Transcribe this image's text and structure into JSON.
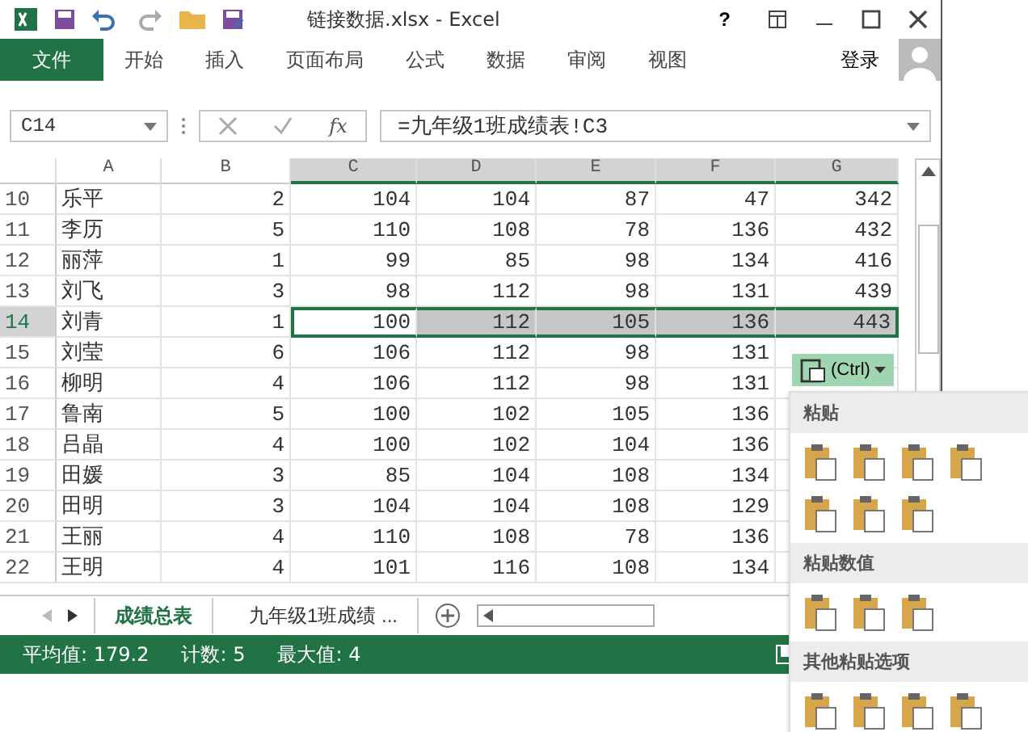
{
  "window": {
    "title": "链接数据.xlsx - Excel",
    "help": "?"
  },
  "ribbon_tabs": [
    {
      "label": "文件",
      "selected": true
    },
    {
      "label": "开始",
      "selected": false
    },
    {
      "label": "插入",
      "selected": false
    },
    {
      "label": "页面布局",
      "selected": false
    },
    {
      "label": "公式",
      "selected": false
    },
    {
      "label": "数据",
      "selected": false
    },
    {
      "label": "审阅",
      "selected": false
    },
    {
      "label": "视图",
      "selected": false
    }
  ],
  "sign_in": "登录",
  "formula_bar": {
    "name_box": "C14",
    "fx": "fx",
    "formula": "=九年级1班成绩表!C3"
  },
  "sheet": {
    "columns": [
      {
        "label": "A",
        "selected": false
      },
      {
        "label": "B",
        "selected": false
      },
      {
        "label": "C",
        "selected": true
      },
      {
        "label": "D",
        "selected": true
      },
      {
        "label": "E",
        "selected": true
      },
      {
        "label": "F",
        "selected": true
      },
      {
        "label": "G",
        "selected": true
      }
    ],
    "rows": [
      {
        "number": "10",
        "selected": false,
        "cells": [
          "乐平",
          "2",
          "104",
          "104",
          "87",
          "47",
          "342"
        ]
      },
      {
        "number": "11",
        "selected": false,
        "cells": [
          "李历",
          "5",
          "110",
          "108",
          "78",
          "136",
          "432"
        ]
      },
      {
        "number": "12",
        "selected": false,
        "cells": [
          "丽萍",
          "1",
          "99",
          "85",
          "98",
          "134",
          "416"
        ]
      },
      {
        "number": "13",
        "selected": false,
        "cells": [
          "刘飞",
          "3",
          "98",
          "112",
          "98",
          "131",
          "439"
        ]
      },
      {
        "number": "14",
        "selected": true,
        "cells": [
          "刘青",
          "1",
          "100",
          "112",
          "105",
          "136",
          "443"
        ]
      },
      {
        "number": "15",
        "selected": false,
        "cells": [
          "刘莹",
          "6",
          "106",
          "112",
          "98",
          "131"
        ]
      },
      {
        "number": "16",
        "selected": false,
        "cells": [
          "柳明",
          "4",
          "106",
          "112",
          "98",
          "131"
        ]
      },
      {
        "number": "17",
        "selected": false,
        "cells": [
          "鲁南",
          "5",
          "100",
          "102",
          "105",
          "136"
        ]
      },
      {
        "number": "18",
        "selected": false,
        "cells": [
          "吕晶",
          "4",
          "100",
          "102",
          "104",
          "136"
        ]
      },
      {
        "number": "19",
        "selected": false,
        "cells": [
          "田媛",
          "3",
          "85",
          "104",
          "108",
          "134"
        ]
      },
      {
        "number": "20",
        "selected": false,
        "cells": [
          "田明",
          "3",
          "104",
          "104",
          "108",
          "129"
        ]
      },
      {
        "number": "21",
        "selected": false,
        "cells": [
          "王丽",
          "4",
          "110",
          "108",
          "78",
          "136"
        ]
      },
      {
        "number": "22",
        "selected": false,
        "cells": [
          "王明",
          "4",
          "101",
          "116",
          "108",
          "134"
        ]
      }
    ]
  },
  "sheet_tabs": [
    {
      "label": "成绩总表",
      "selected": true
    },
    {
      "label": "九年级1班成绩 ...",
      "selected": false
    }
  ],
  "status_bar": [
    "平均值: 179.2",
    "计数: 5",
    "最大值: 4"
  ],
  "paste_popup": {
    "button": "(Ctrl)",
    "sections": [
      {
        "title": "粘贴"
      },
      {
        "title": "粘贴数值"
      },
      {
        "title": "其他粘贴选项"
      }
    ]
  }
}
